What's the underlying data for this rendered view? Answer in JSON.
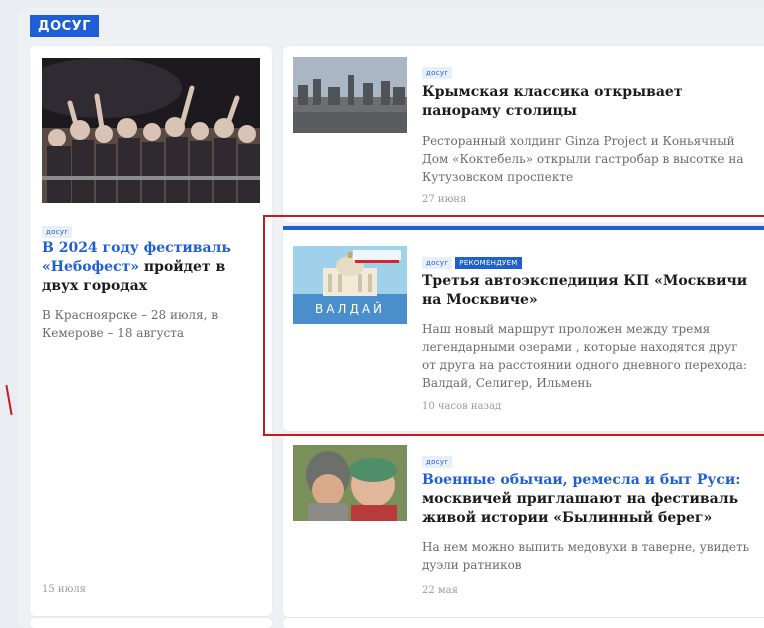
{
  "section": {
    "label": "ДОСУГ"
  },
  "left_article": {
    "tag": "досуг",
    "title_link": "В 2024 году фестиваль «Небофест»",
    "title_rest": " пройдет в двух городах",
    "description": "В Красноярске – 28 июля, в Кемерове – 18 августа",
    "date": "15 июля",
    "image": "festival-crowd-photo"
  },
  "articles": [
    {
      "tag": "досуг",
      "title": "Крымская классика открывает панораму столицы",
      "description": "Ресторанный холдинг Ginza Project и Коньячный Дом «Коктебель» открыли гастробар в высотке на Кутузовском проспекте",
      "date": "27 июня",
      "image": "moscow-panorama-photo"
    },
    {
      "tag": "досуг",
      "badge": "РЕКОМЕНДУЕМ",
      "title": "Третья автоэкспедиция КП «Москвичи на Москвиче»",
      "description": "Наш новый маршрут проложен между тремя легендарными озерами , которые находятся друг от друга на расстоянии одного дневного перехода: Валдай, Селигер, Ильмень",
      "date": "10 часов назад",
      "image_caption": "ВАЛДАЙ",
      "image": "valdai-illustration"
    },
    {
      "tag": "досуг",
      "title_link": "Военные обычаи, ремесла и быт Руси:",
      "title_rest": " москвичей приглашают на фестиваль живой истории «Былинный берег»",
      "description": "На нем можно выпить медовухи в таверне, увидеть дуэли ратников",
      "date": "22 мая",
      "image": "reenactors-photo"
    }
  ],
  "colors": {
    "accent": "#1f5fd6",
    "highlight": "#c8191f"
  }
}
